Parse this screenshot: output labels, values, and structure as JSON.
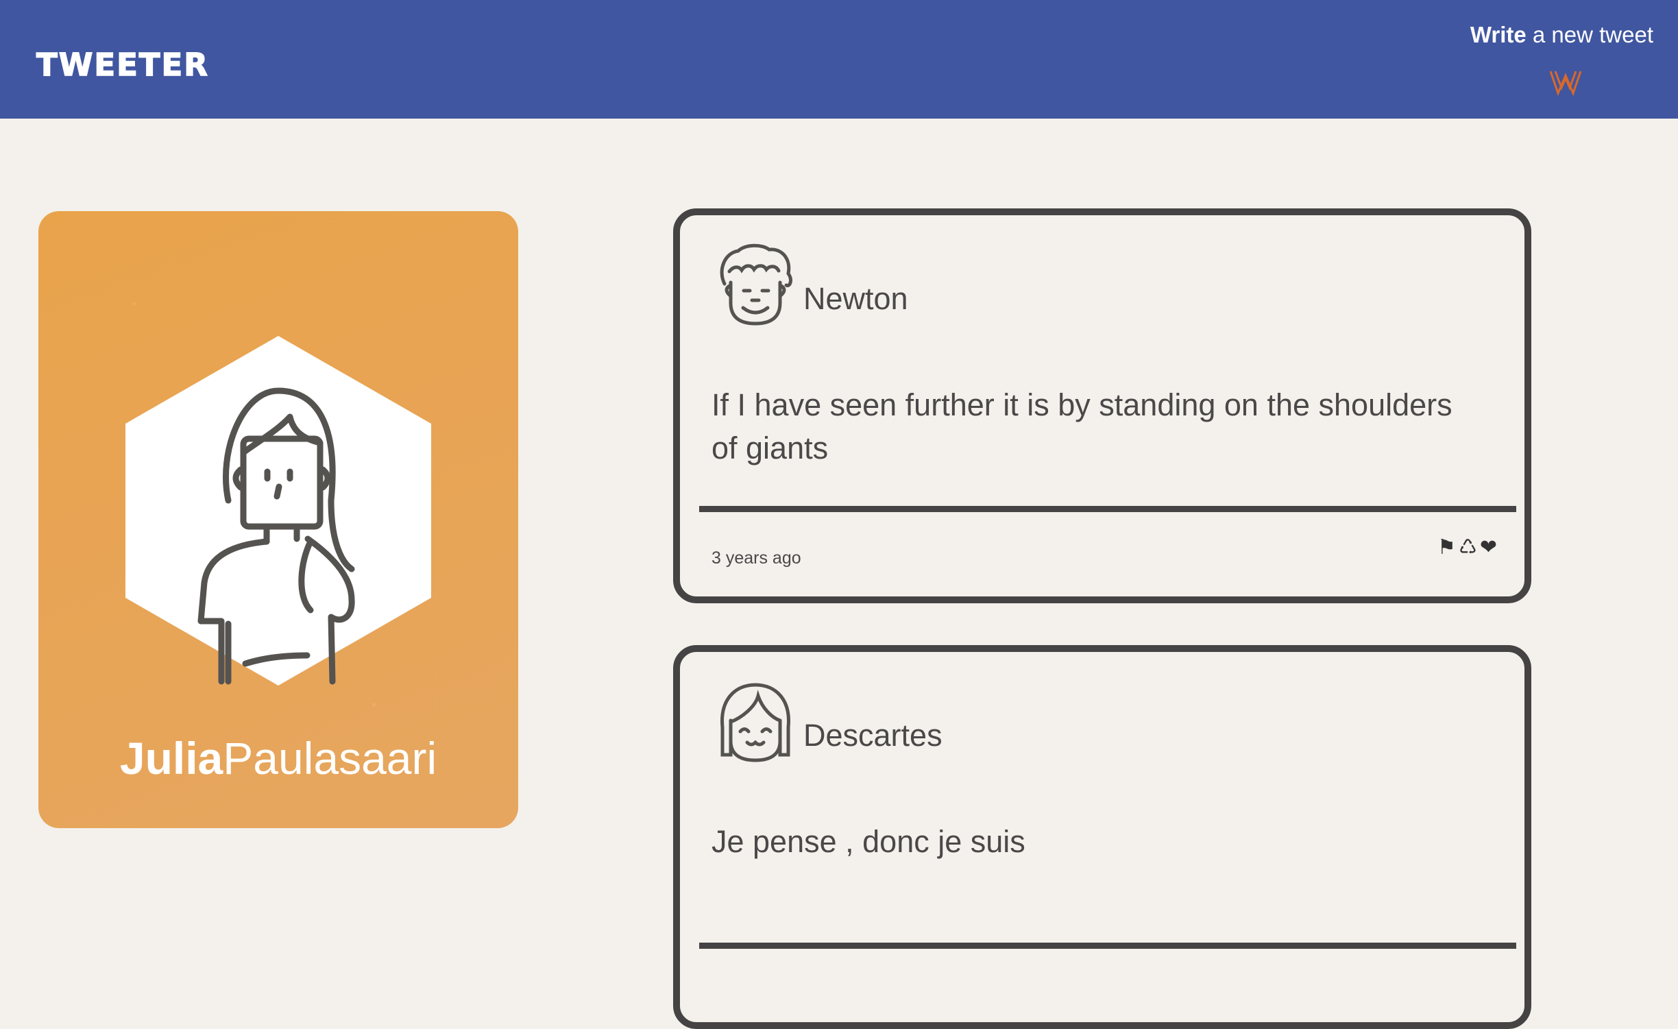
{
  "navbar": {
    "brand": "TWEETER",
    "compose_bold": "Write",
    "compose_rest": " a new tweet",
    "compose_icon": "double-chevron-down-icon",
    "accent": "#d9682b"
  },
  "profile": {
    "first_name": "Julia",
    "last_name": "Paulasaari",
    "avatar_icon": "woman-avatar-icon",
    "card_color": "#e8a352"
  },
  "tweets": [
    {
      "author": "Newton",
      "avatar_icon": "curly-hair-man-avatar-icon",
      "text": "If I have seen further it is by standing on the shoulders of giants",
      "time": "3 years ago",
      "actions": {
        "flag": "⚑",
        "retweet": "♺",
        "like": "❤"
      }
    },
    {
      "author": "Descartes",
      "avatar_icon": "bob-hair-smiling-avatar-icon",
      "text": "Je pense , donc je suis"
    }
  ],
  "colors": {
    "navbar": "#4056a0",
    "background": "#f4f1ec",
    "border": "#454343"
  }
}
